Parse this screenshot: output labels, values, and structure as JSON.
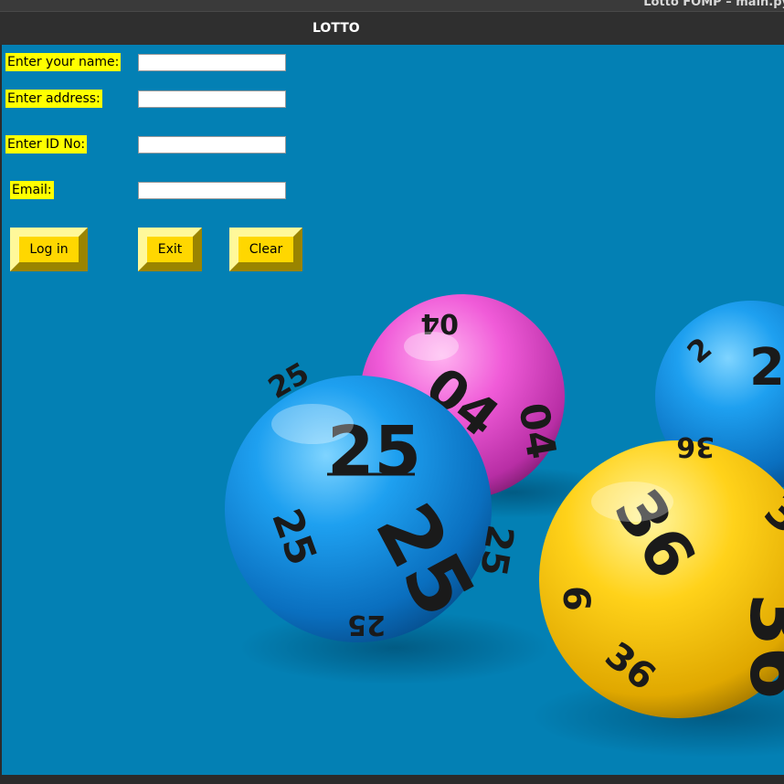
{
  "background_window": {
    "title": "Lotto FOMP – main.py"
  },
  "window": {
    "title": "LOTTO"
  },
  "form": {
    "name_label": "Enter your name:",
    "address_label": "Enter address:",
    "id_label": "Enter ID No:",
    "email_label": "Email:",
    "name_value": "",
    "address_value": "",
    "id_value": "",
    "email_value": ""
  },
  "buttons": {
    "login": "Log in",
    "exit": "Exit",
    "clear": "Clear"
  },
  "balls": {
    "blue": "25",
    "pink": "04",
    "yellow": "36",
    "blue_back": "2"
  },
  "colors": {
    "background": "#0380b4",
    "label_bg": "#ffff00",
    "button_bg": "#ffd700"
  }
}
